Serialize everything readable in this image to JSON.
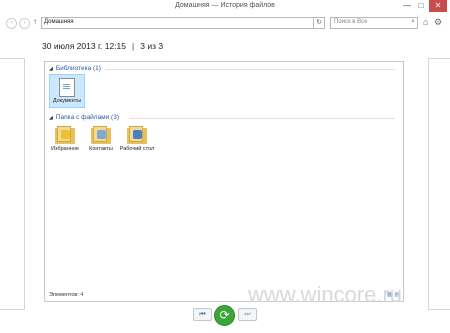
{
  "window": {
    "title": "Домашняя — История файлов",
    "minimize_glyph": "—",
    "maximize_glyph": "□",
    "close_glyph": "✕"
  },
  "nav": {
    "back_glyph": "‹",
    "forward_glyph": "›",
    "up_glyph": "↑",
    "address": "Домашняя",
    "dropdown_glyph": "▾",
    "refresh_glyph": "↻",
    "search_placeholder": "Поиск в Все",
    "search_glyph": "⌕",
    "home_glyph": "⌂",
    "settings_glyph": "⚙"
  },
  "header": {
    "date": "30 июля 2013 г. 12:15",
    "separator": "|",
    "position": "3 из 3"
  },
  "groups": [
    {
      "label": "Библиотека (1)",
      "items": [
        {
          "label": "Документы"
        }
      ]
    },
    {
      "label": "Папка с файлами (3)",
      "items": [
        {
          "label": "Избранное"
        },
        {
          "label": "Контакты"
        },
        {
          "label": "Рабочий стол"
        }
      ]
    }
  ],
  "status": {
    "label": "Элементов:",
    "count": "4"
  },
  "controls": {
    "prev_glyph": "⏮",
    "restore_glyph": "⟳",
    "next_glyph": "⏭"
  },
  "watermark": "www.wincore.ru",
  "colors": {
    "accent": "#2a5b9a",
    "restore": "#3aa63a",
    "selection": "#cce8ff",
    "folder": "#e8c060"
  }
}
